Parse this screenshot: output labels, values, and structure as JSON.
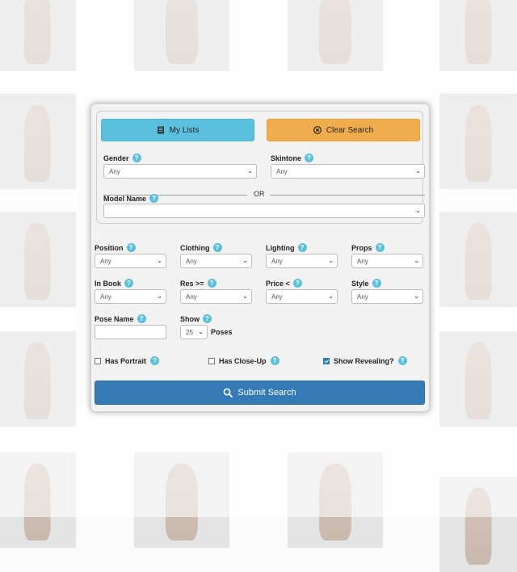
{
  "buttons": {
    "my_lists": "My Lists",
    "clear_search": "Clear Search",
    "submit": "Submit Search"
  },
  "help_glyph": "?",
  "gender": {
    "label": "Gender",
    "value": "Any"
  },
  "skintone": {
    "label": "Skintone",
    "value": "Any"
  },
  "or_text": "OR",
  "model_name": {
    "label": "Model Name",
    "value": ""
  },
  "filters_row1": [
    {
      "label": "Position",
      "value": "Any"
    },
    {
      "label": "Clothing",
      "value": "Any"
    },
    {
      "label": "Lighting",
      "value": "Any"
    },
    {
      "label": "Props",
      "value": "Any"
    }
  ],
  "filters_row2": [
    {
      "label": "In Book",
      "value": "Any"
    },
    {
      "label": "Res >=",
      "value": "Any"
    },
    {
      "label": "Price <",
      "value": "Any"
    },
    {
      "label": "Style",
      "value": "Any"
    }
  ],
  "pose_name": {
    "label": "Pose Name",
    "value": ""
  },
  "show": {
    "label": "Show",
    "value": "25",
    "suffix": "Poses"
  },
  "checkboxes": [
    {
      "label": "Has Portrait",
      "checked": false
    },
    {
      "label": "Has Close-Up",
      "checked": false
    },
    {
      "label": "Show Revealing?",
      "checked": true
    }
  ],
  "colors": {
    "info": "#5bc0de",
    "warning": "#f0ad4e",
    "primary": "#337ab7"
  },
  "icons": {
    "my_lists": "book-icon",
    "clear_search": "clear-circle-icon",
    "submit": "search-icon",
    "select": "chevron-down-icon",
    "help": "help-icon"
  }
}
